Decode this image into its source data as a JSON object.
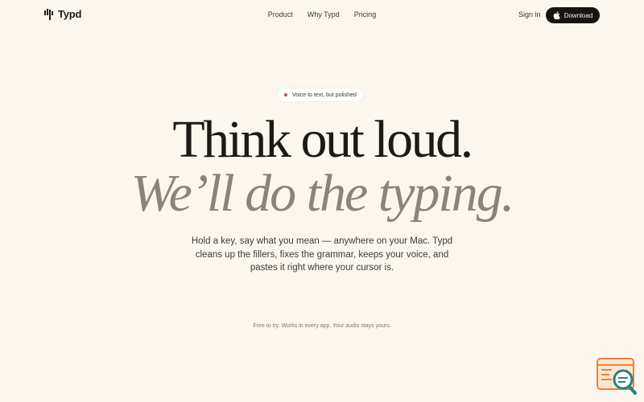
{
  "header": {
    "brand": "Typd",
    "nav": [
      {
        "label": "Product"
      },
      {
        "label": "Why Typd"
      },
      {
        "label": "Pricing"
      }
    ],
    "sign_in_label": "Sign in",
    "download_label": "Download"
  },
  "hero": {
    "badge_text": "Voice to text, but polished",
    "headline": "Think out loud.",
    "subheadline": "We’ll do the typing.",
    "lede": "Hold a key, say what you mean — anywhere on your Mac. Typd cleans up the fillers, fixes the grammar, keeps your voice, and pastes it right where your cursor is.",
    "fineprint": "Free to try. Works in every app. Your audio stays yours."
  },
  "icons": {
    "logo": "microphone-bars-icon",
    "download": "apple-icon",
    "badge": "recording-dot-icon",
    "widget": "search-feedback-icon"
  },
  "colors": {
    "background": "#fbf7ef",
    "text": "#1c1a17",
    "muted_italic": "#8a857c",
    "download_button": "#161512",
    "badge_dot": "#c94a4a",
    "widget_accent": "#e8833a",
    "widget_teal": "#2a7f80"
  }
}
